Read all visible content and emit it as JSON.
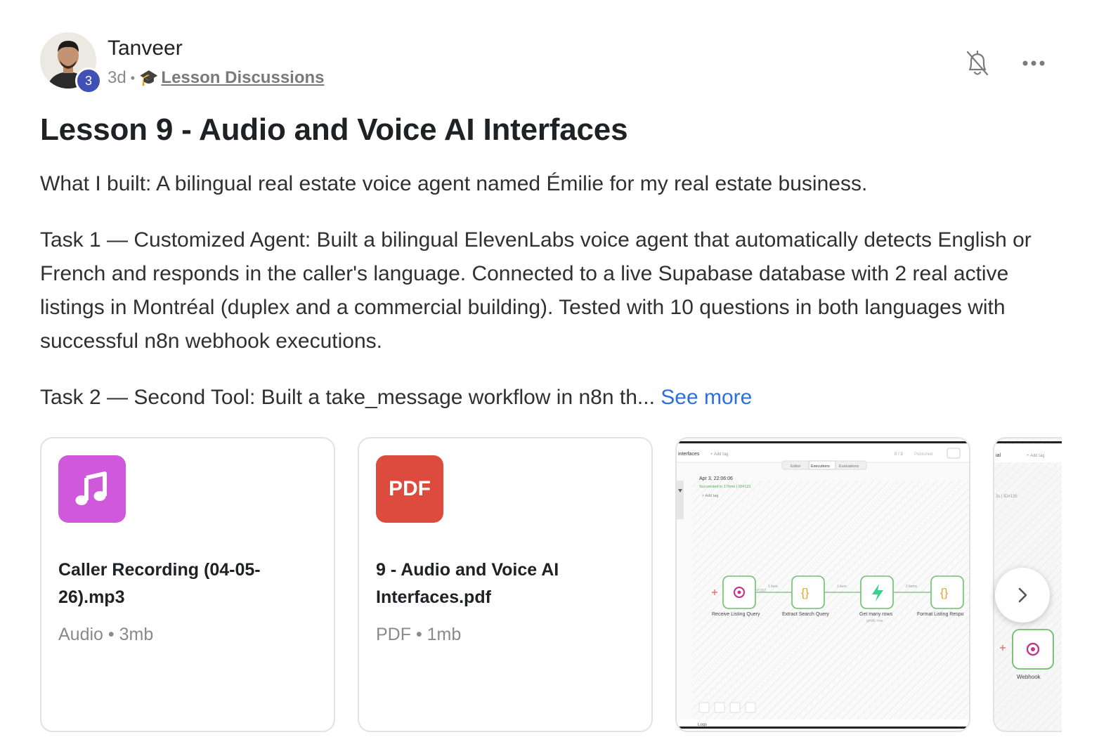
{
  "post": {
    "author": "Tanveer",
    "level": "3",
    "time": "3d",
    "separator": "•",
    "category_emoji": "🎓",
    "category": "Lesson Discussions",
    "title": "Lesson 9 - Audio and Voice AI Interfaces",
    "paragraph_1": "What I built: A bilingual real estate voice agent named Émilie for my real estate business.",
    "paragraph_2": "Task 1 — Customized Agent: Built a bilingual ElevenLabs voice agent that automatically detects English or French and responds in the caller's language. Connected to a live Supabase database with 2 real active listings in Montréal (duplex and a commercial building). Tested with 10 questions in both languages with successful n8n webhook executions.",
    "paragraph_3": "Task 2 — Second Tool: Built a take_message workflow in n8n th...",
    "see_more": "See more"
  },
  "attachments": [
    {
      "name": "Caller Recording (04-05-26).mp3",
      "meta": "Audio • 3mb",
      "icon": "music-note-icon"
    },
    {
      "name": "9 - Audio and Voice AI Interfaces.pdf",
      "meta": "PDF • 1mb",
      "icon_label": "PDF"
    }
  ],
  "screenshot_1": {
    "tab_label": "interfaces",
    "add_tag": "+ Add tag",
    "counter": "0 / 3",
    "published": "Published",
    "tabs": [
      "Editor",
      "Executions",
      "Evaluations"
    ],
    "exec_time": "Apr 3, 22:06:06",
    "exec_status": "Succeeded in 176ms | ID#121",
    "add_tag_2": "+ Add tag",
    "nodes": [
      {
        "label": "Receive Listing Query",
        "sub": "POST"
      },
      {
        "label": "Extract Search Query"
      },
      {
        "label": "Get many rows",
        "sub": "getAll: row"
      },
      {
        "label": "Format Listing Respo"
      }
    ],
    "edges": [
      "1 item",
      "1 item",
      "2 items"
    ],
    "logs": "Logs"
  },
  "screenshot_2": {
    "tab_label": "ial",
    "add_tag": "+ Add tag",
    "exec_id": "3s | ID#135",
    "node_label": "Webhook"
  },
  "colors": {
    "accent_link": "#2e6fde",
    "audio_icon": "#cf58db",
    "pdf_icon": "#dd4b3e",
    "level_badge": "#3f51b5"
  }
}
